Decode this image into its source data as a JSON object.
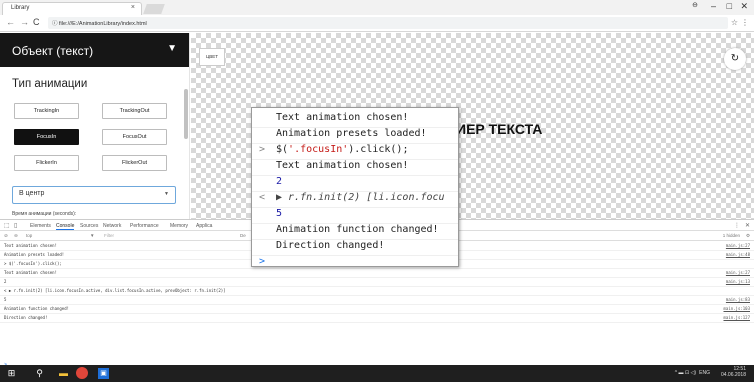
{
  "browser": {
    "tab_title": "Library",
    "tab_close": "×",
    "url": "file:///E:/AnimationLibrary/index.html",
    "win_min": "–",
    "win_max": "□",
    "win_close": "✕",
    "account_icon": "account-icon"
  },
  "panel": {
    "header": "Объект (текст)",
    "section_title": "Тип анимации",
    "buttons": [
      {
        "label": "TrackingIn",
        "active": false
      },
      {
        "label": "TrackingOut",
        "active": false
      },
      {
        "label": "FocusIn",
        "active": true
      },
      {
        "label": "FocusOut",
        "active": false
      },
      {
        "label": "FlickerIn",
        "active": false
      },
      {
        "label": "FlickerOut",
        "active": false
      }
    ],
    "direction_value": "В центр",
    "duration_label": "Время анимации (seconds):"
  },
  "canvas": {
    "color_button": "ЦВЕТ",
    "sample_text": "ИЕР ТЕКСТА"
  },
  "devtools": {
    "tabs": [
      "Elements",
      "Console",
      "Sources",
      "Network",
      "Performance",
      "Memory",
      "Applica"
    ],
    "active_tab": "Console",
    "context": "top",
    "filter_placeholder": "Filter",
    "default_levels": "De",
    "hidden_count": "1 hidden",
    "lines": [
      {
        "text": "Text animation chosen!",
        "src": "main.js:27"
      },
      {
        "text": "Animation presets loaded!",
        "src": "main.js:48"
      },
      {
        "text": "> $('.focusIn').click();",
        "src": ""
      },
      {
        "text": "Text animation chosen!",
        "src": "main.js:27"
      },
      {
        "text": "2",
        "src": "main.js:13"
      },
      {
        "text": "< ▶ r.fn.init(2) [li.icon.focusIn.active, div.list.focusIn.active, prevObject: r.fn.init(2)]",
        "src": ""
      },
      {
        "text": "5",
        "src": "main.js:83"
      },
      {
        "text": "Animation function changed!",
        "src": "main.js:103"
      },
      {
        "text": "Direction changed!",
        "src": "main.js:127"
      }
    ],
    "prompt": ">"
  },
  "zoom": {
    "lines": [
      {
        "prefix": "",
        "parts": [
          {
            "t": "Text animation chosen!",
            "c": ""
          }
        ]
      },
      {
        "prefix": "",
        "parts": [
          {
            "t": "Animation presets loaded!",
            "c": ""
          }
        ]
      },
      {
        "prefix": ">",
        "parts": [
          {
            "t": "$(",
            "c": ""
          },
          {
            "t": "'.focusIn'",
            "c": "str"
          },
          {
            "t": ").click();",
            "c": ""
          }
        ]
      },
      {
        "prefix": "",
        "parts": [
          {
            "t": "Text animation chosen!",
            "c": ""
          }
        ]
      },
      {
        "prefix": "",
        "parts": [
          {
            "t": "2",
            "c": "num"
          }
        ]
      },
      {
        "prefix": "<",
        "parts": [
          {
            "t": "▶ r.fn.init(2) [li.icon.focu",
            "c": "ital"
          }
        ]
      },
      {
        "prefix": "",
        "parts": [
          {
            "t": "5",
            "c": "num"
          }
        ]
      },
      {
        "prefix": "",
        "parts": [
          {
            "t": "Animation function changed!",
            "c": ""
          }
        ]
      },
      {
        "prefix": "",
        "parts": [
          {
            "t": "Direction changed!",
            "c": ""
          }
        ]
      },
      {
        "prefix": ">",
        "parts": []
      }
    ]
  },
  "taskbar": {
    "lang": "ENG",
    "time": "12:51",
    "date": "04.06.2018"
  }
}
